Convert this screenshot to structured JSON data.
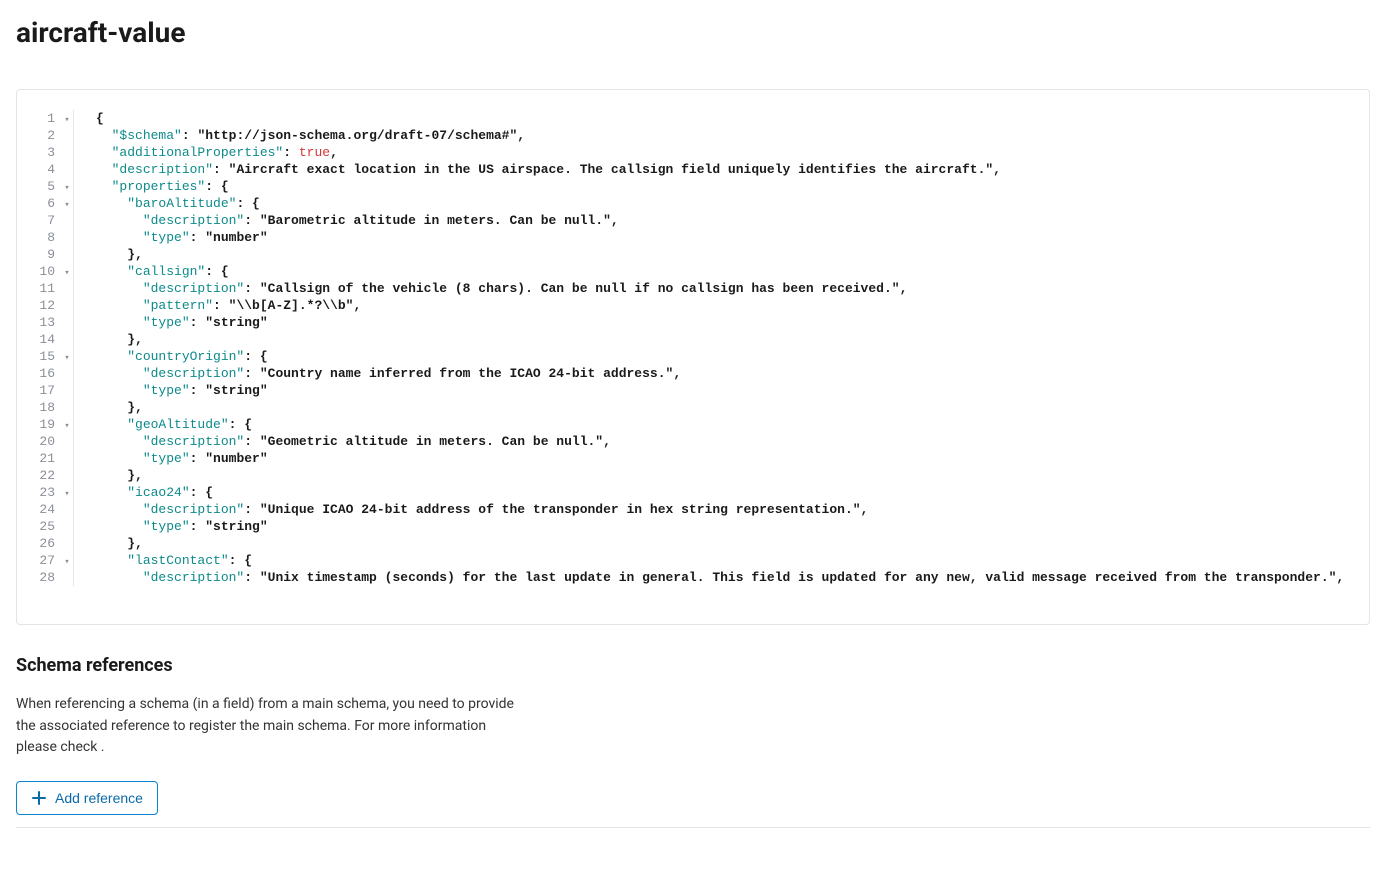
{
  "header": {
    "title": "aircraft-value"
  },
  "code": {
    "lines": [
      {
        "n": 1,
        "fold": "▾",
        "indent": 0,
        "tokens": [
          {
            "t": "punc",
            "v": "{"
          }
        ]
      },
      {
        "n": 2,
        "fold": "",
        "indent": 1,
        "tokens": [
          {
            "t": "key",
            "v": "\"$schema\""
          },
          {
            "t": "punc",
            "v": ": "
          },
          {
            "t": "str",
            "v": "\"http://json-schema.org/draft-07/schema#\""
          },
          {
            "t": "punc",
            "v": ","
          }
        ]
      },
      {
        "n": 3,
        "fold": "",
        "indent": 1,
        "tokens": [
          {
            "t": "key",
            "v": "\"additionalProperties\""
          },
          {
            "t": "punc",
            "v": ": "
          },
          {
            "t": "bool",
            "v": "true"
          },
          {
            "t": "punc",
            "v": ","
          }
        ]
      },
      {
        "n": 4,
        "fold": "",
        "indent": 1,
        "tokens": [
          {
            "t": "key",
            "v": "\"description\""
          },
          {
            "t": "punc",
            "v": ": "
          },
          {
            "t": "str",
            "v": "\"Aircraft exact location in the US airspace. The callsign field uniquely identifies the aircraft.\""
          },
          {
            "t": "punc",
            "v": ","
          }
        ]
      },
      {
        "n": 5,
        "fold": "▾",
        "indent": 1,
        "tokens": [
          {
            "t": "key",
            "v": "\"properties\""
          },
          {
            "t": "punc",
            "v": ": {"
          }
        ]
      },
      {
        "n": 6,
        "fold": "▾",
        "indent": 2,
        "tokens": [
          {
            "t": "key",
            "v": "\"baroAltitude\""
          },
          {
            "t": "punc",
            "v": ": {"
          }
        ]
      },
      {
        "n": 7,
        "fold": "",
        "indent": 3,
        "tokens": [
          {
            "t": "key",
            "v": "\"description\""
          },
          {
            "t": "punc",
            "v": ": "
          },
          {
            "t": "str",
            "v": "\"Barometric altitude in meters. Can be null.\""
          },
          {
            "t": "punc",
            "v": ","
          }
        ]
      },
      {
        "n": 8,
        "fold": "",
        "indent": 3,
        "tokens": [
          {
            "t": "key",
            "v": "\"type\""
          },
          {
            "t": "punc",
            "v": ": "
          },
          {
            "t": "str",
            "v": "\"number\""
          }
        ]
      },
      {
        "n": 9,
        "fold": "",
        "indent": 2,
        "tokens": [
          {
            "t": "punc",
            "v": "},"
          }
        ]
      },
      {
        "n": 10,
        "fold": "▾",
        "indent": 2,
        "tokens": [
          {
            "t": "key",
            "v": "\"callsign\""
          },
          {
            "t": "punc",
            "v": ": {"
          }
        ]
      },
      {
        "n": 11,
        "fold": "",
        "indent": 3,
        "tokens": [
          {
            "t": "key",
            "v": "\"description\""
          },
          {
            "t": "punc",
            "v": ": "
          },
          {
            "t": "str",
            "v": "\"Callsign of the vehicle (8 chars). Can be null if no callsign has been received.\""
          },
          {
            "t": "punc",
            "v": ","
          }
        ]
      },
      {
        "n": 12,
        "fold": "",
        "indent": 3,
        "tokens": [
          {
            "t": "key",
            "v": "\"pattern\""
          },
          {
            "t": "punc",
            "v": ": "
          },
          {
            "t": "str",
            "v": "\"\\\\b[A-Z].*?\\\\b\""
          },
          {
            "t": "punc",
            "v": ","
          }
        ]
      },
      {
        "n": 13,
        "fold": "",
        "indent": 3,
        "tokens": [
          {
            "t": "key",
            "v": "\"type\""
          },
          {
            "t": "punc",
            "v": ": "
          },
          {
            "t": "str",
            "v": "\"string\""
          }
        ]
      },
      {
        "n": 14,
        "fold": "",
        "indent": 2,
        "tokens": [
          {
            "t": "punc",
            "v": "},"
          }
        ]
      },
      {
        "n": 15,
        "fold": "▾",
        "indent": 2,
        "tokens": [
          {
            "t": "key",
            "v": "\"countryOrigin\""
          },
          {
            "t": "punc",
            "v": ": {"
          }
        ]
      },
      {
        "n": 16,
        "fold": "",
        "indent": 3,
        "tokens": [
          {
            "t": "key",
            "v": "\"description\""
          },
          {
            "t": "punc",
            "v": ": "
          },
          {
            "t": "str",
            "v": "\"Country name inferred from the ICAO 24-bit address.\""
          },
          {
            "t": "punc",
            "v": ","
          }
        ]
      },
      {
        "n": 17,
        "fold": "",
        "indent": 3,
        "tokens": [
          {
            "t": "key",
            "v": "\"type\""
          },
          {
            "t": "punc",
            "v": ": "
          },
          {
            "t": "str",
            "v": "\"string\""
          }
        ]
      },
      {
        "n": 18,
        "fold": "",
        "indent": 2,
        "tokens": [
          {
            "t": "punc",
            "v": "},"
          }
        ]
      },
      {
        "n": 19,
        "fold": "▾",
        "indent": 2,
        "tokens": [
          {
            "t": "key",
            "v": "\"geoAltitude\""
          },
          {
            "t": "punc",
            "v": ": {"
          }
        ]
      },
      {
        "n": 20,
        "fold": "",
        "indent": 3,
        "tokens": [
          {
            "t": "key",
            "v": "\"description\""
          },
          {
            "t": "punc",
            "v": ": "
          },
          {
            "t": "str",
            "v": "\"Geometric altitude in meters. Can be null.\""
          },
          {
            "t": "punc",
            "v": ","
          }
        ]
      },
      {
        "n": 21,
        "fold": "",
        "indent": 3,
        "tokens": [
          {
            "t": "key",
            "v": "\"type\""
          },
          {
            "t": "punc",
            "v": ": "
          },
          {
            "t": "str",
            "v": "\"number\""
          }
        ]
      },
      {
        "n": 22,
        "fold": "",
        "indent": 2,
        "tokens": [
          {
            "t": "punc",
            "v": "},"
          }
        ]
      },
      {
        "n": 23,
        "fold": "▾",
        "indent": 2,
        "tokens": [
          {
            "t": "key",
            "v": "\"icao24\""
          },
          {
            "t": "punc",
            "v": ": {"
          }
        ]
      },
      {
        "n": 24,
        "fold": "",
        "indent": 3,
        "tokens": [
          {
            "t": "key",
            "v": "\"description\""
          },
          {
            "t": "punc",
            "v": ": "
          },
          {
            "t": "str",
            "v": "\"Unique ICAO 24-bit address of the transponder in hex string representation.\""
          },
          {
            "t": "punc",
            "v": ","
          }
        ]
      },
      {
        "n": 25,
        "fold": "",
        "indent": 3,
        "tokens": [
          {
            "t": "key",
            "v": "\"type\""
          },
          {
            "t": "punc",
            "v": ": "
          },
          {
            "t": "str",
            "v": "\"string\""
          }
        ]
      },
      {
        "n": 26,
        "fold": "",
        "indent": 2,
        "tokens": [
          {
            "t": "punc",
            "v": "},"
          }
        ]
      },
      {
        "n": 27,
        "fold": "▾",
        "indent": 2,
        "tokens": [
          {
            "t": "key",
            "v": "\"lastContact\""
          },
          {
            "t": "punc",
            "v": ": {"
          }
        ]
      },
      {
        "n": 28,
        "fold": "",
        "indent": 3,
        "tokens": [
          {
            "t": "key",
            "v": "\"description\""
          },
          {
            "t": "punc",
            "v": ": "
          },
          {
            "t": "str",
            "v": "\"Unix timestamp (seconds) for the last update in general. This field is updated for any new, valid message received from the transponder.\""
          },
          {
            "t": "punc",
            "v": ","
          }
        ]
      }
    ]
  },
  "references": {
    "heading": "Schema references",
    "description": "When referencing a schema (in a field) from a main schema, you need to provide the associated reference to register the main schema. For more information please check .",
    "button_label": "Add reference"
  }
}
